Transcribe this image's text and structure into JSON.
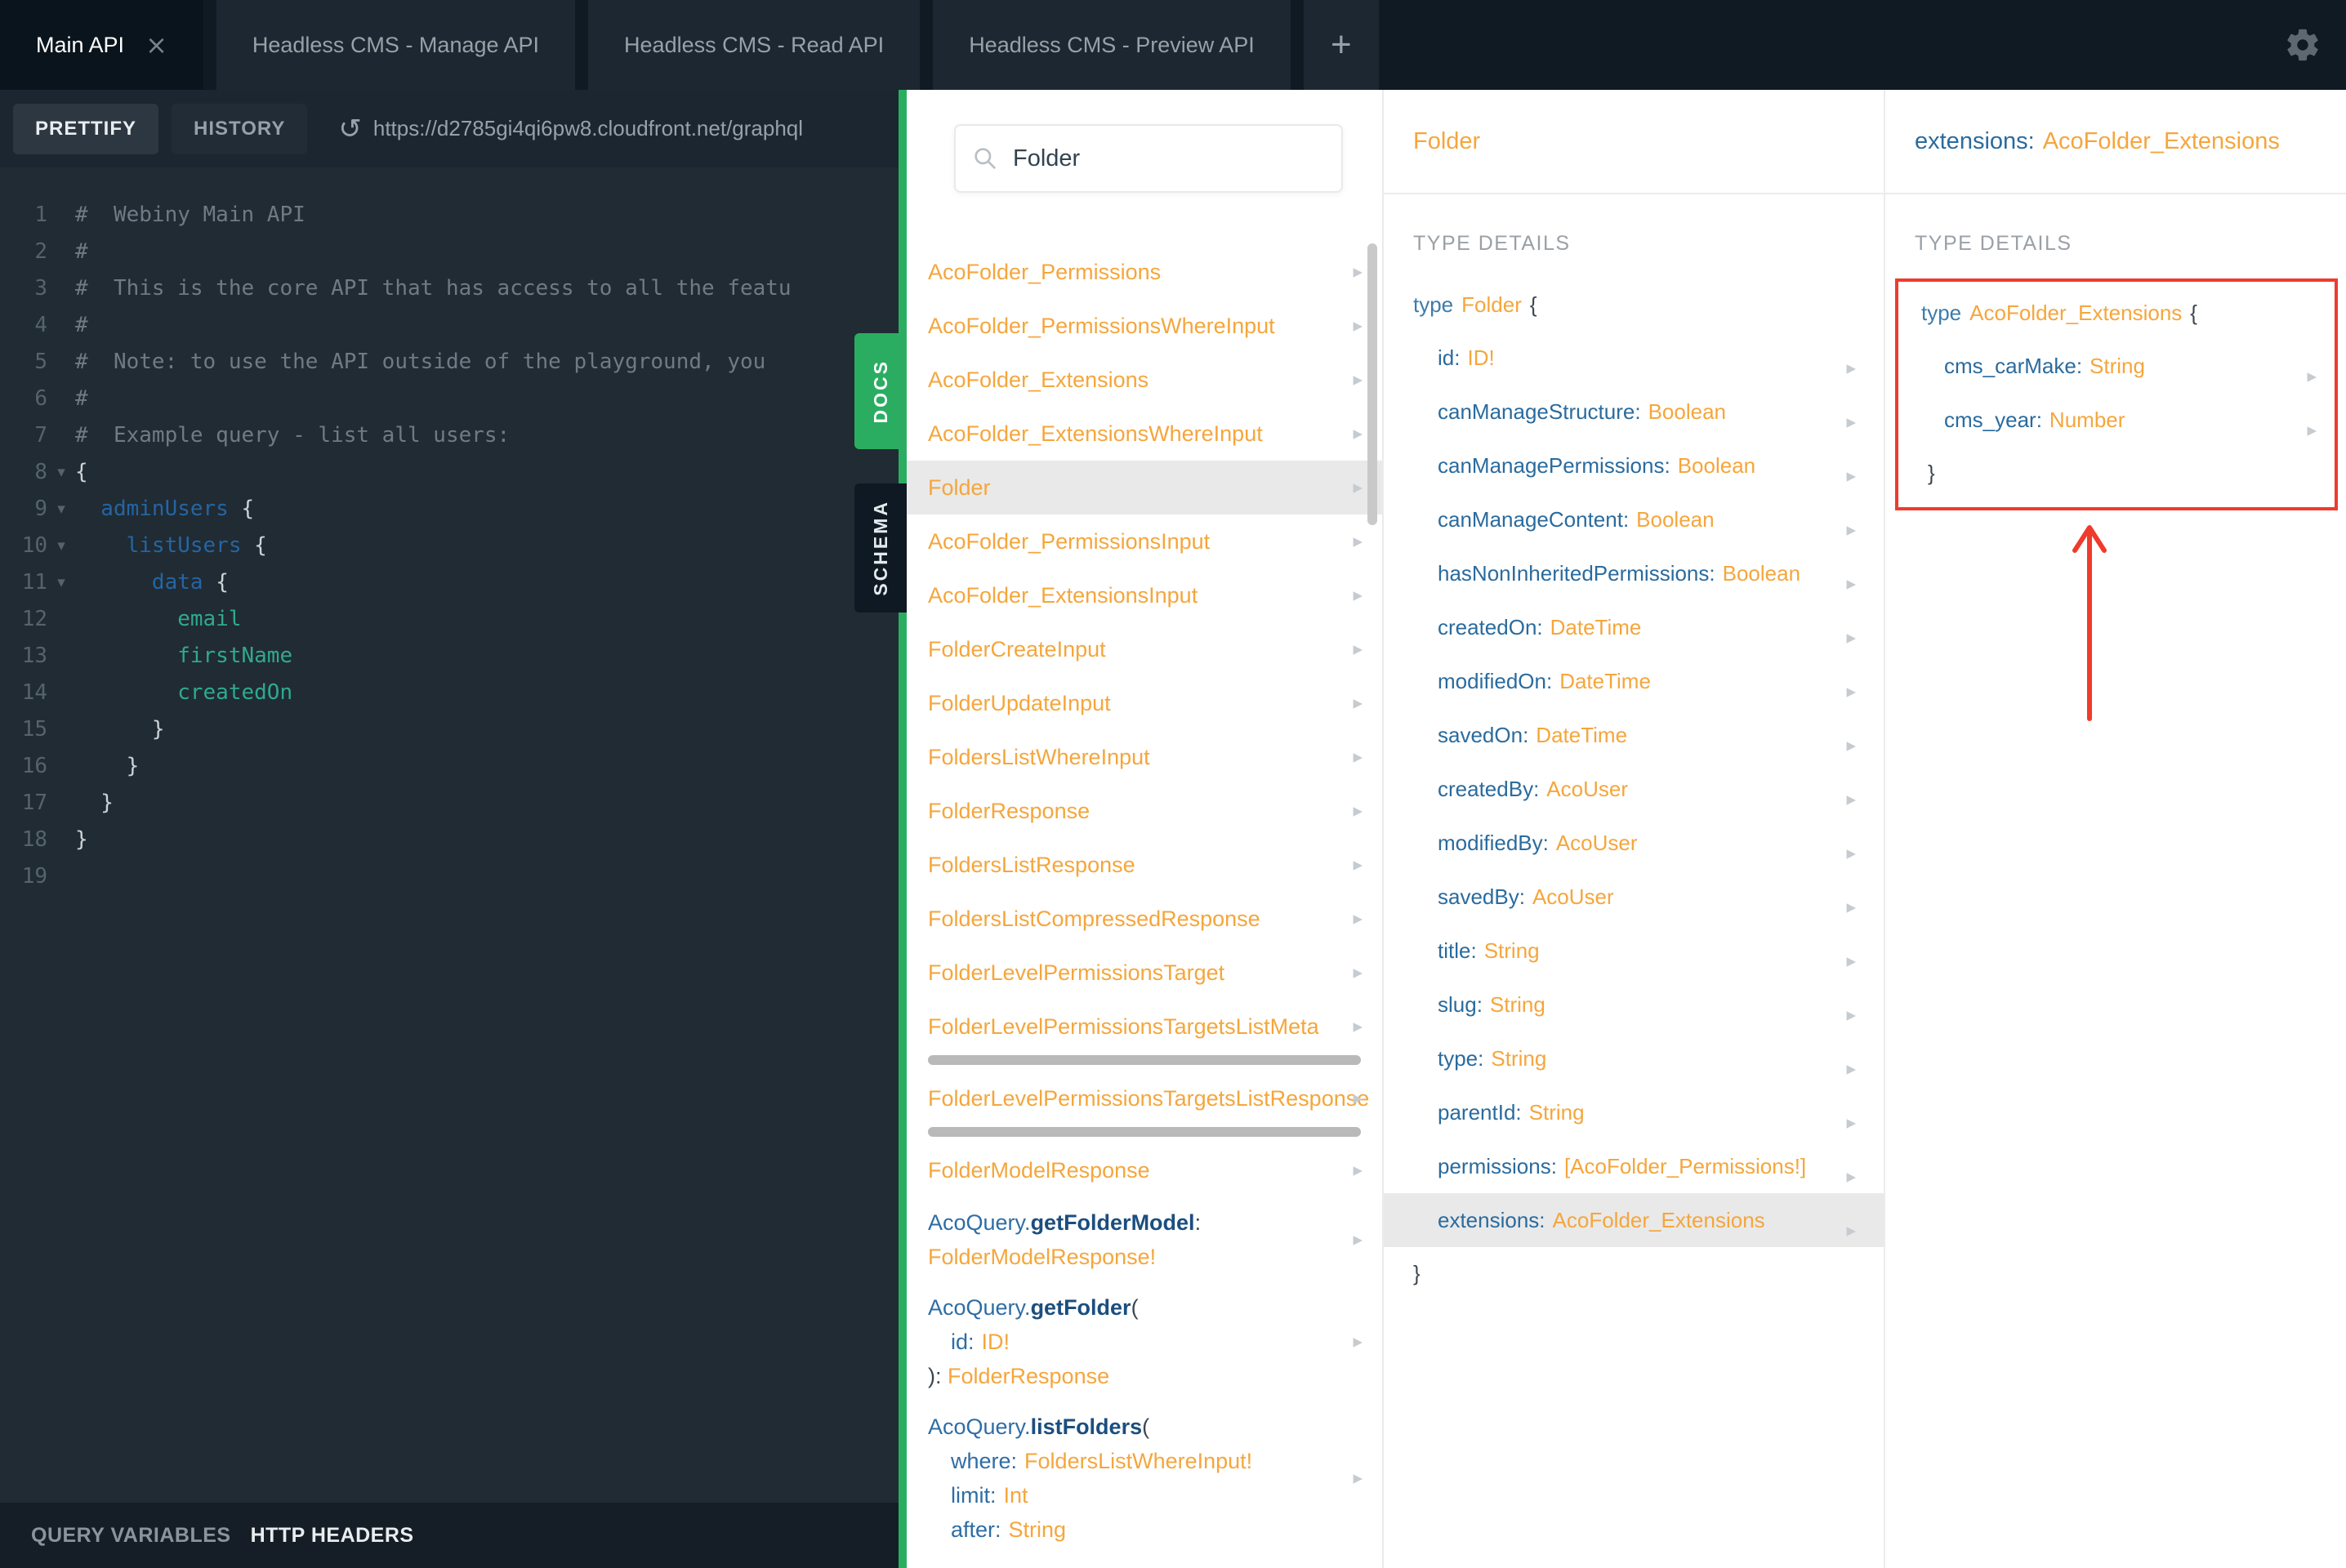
{
  "icons": {
    "chevron": "▸",
    "fold": "▾",
    "close": "×",
    "plus": "+",
    "refresh": "↺"
  },
  "tab_bar": {
    "tabs": [
      {
        "label": "Main API"
      },
      {
        "label": "Headless CMS - Manage API"
      },
      {
        "label": "Headless CMS - Read API"
      },
      {
        "label": "Headless CMS - Preview API"
      }
    ]
  },
  "toolbar": {
    "prettify": "PRETTIFY",
    "history": "HISTORY",
    "url": "https://d2785gi4qi6pw8.cloudfront.net/graphql"
  },
  "editor": {
    "lines": [
      {
        "n": "1",
        "s0": "#  Webiny Main API"
      },
      {
        "n": "2",
        "s0": "#"
      },
      {
        "n": "3",
        "s0": "#  This is the core API that has access to all the featu"
      },
      {
        "n": "4",
        "s0": "#"
      },
      {
        "n": "5",
        "s0": "#  Note: to use the API outside of the playground, you"
      },
      {
        "n": "6",
        "s0": "#"
      },
      {
        "n": "7",
        "s0": "#  Example query - list all users:"
      },
      {
        "n": "8",
        "fold": "▾",
        "s0": "{"
      },
      {
        "n": "9",
        "fold": "▾",
        "s0": "  adminUsers ",
        "s1": "{"
      },
      {
        "n": "10",
        "fold": "▾",
        "s0": "    listUsers ",
        "s1": "{"
      },
      {
        "n": "11",
        "fold": "▾",
        "s0": "      data ",
        "s1": "{"
      },
      {
        "n": "12",
        "s0": "        email"
      },
      {
        "n": "13",
        "s0": "        firstName"
      },
      {
        "n": "14",
        "s0": "        createdOn"
      },
      {
        "n": "15",
        "s0": "      }"
      },
      {
        "n": "16",
        "s0": "    }"
      },
      {
        "n": "17",
        "s0": "  }"
      },
      {
        "n": "18",
        "s0": "}"
      },
      {
        "n": "19",
        "s0": ""
      }
    ]
  },
  "bottom_bar": {
    "query_variables": "QUERY VARIABLES",
    "http_headers": "HTTP HEADERS"
  },
  "side_tabs": {
    "docs": "DOCS",
    "schema": "SCHEMA"
  },
  "docs_panel": {
    "search_value": "Folder",
    "items": [
      {
        "label": "AcoFolder_Permissions"
      },
      {
        "label": "AcoFolder_PermissionsWhereInput"
      },
      {
        "label": "AcoFolder_Extensions"
      },
      {
        "label": "AcoFolder_ExtensionsWhereInput"
      },
      {
        "label": "Folder"
      },
      {
        "label": "AcoFolder_PermissionsInput"
      },
      {
        "label": "AcoFolder_ExtensionsInput"
      },
      {
        "label": "FolderCreateInput"
      },
      {
        "label": "FolderUpdateInput"
      },
      {
        "label": "FoldersListWhereInput"
      },
      {
        "label": "FolderResponse"
      },
      {
        "label": "FoldersListResponse"
      },
      {
        "label": "FoldersListCompressedResponse"
      },
      {
        "label": "FolderLevelPermissionsTarget"
      },
      {
        "label": "FolderLevelPermissionsTargetsListMeta"
      },
      {
        "label": "FolderLevelPermissionsTargetsListResponse"
      },
      {
        "label": "FolderModelResponse"
      }
    ],
    "queries": [
      {
        "path": "AcoQuery.",
        "name": "getFolderModel",
        "sep": ":",
        "ret": "FolderModelResponse!"
      },
      {
        "path": "AcoQuery.",
        "name": "getFolder",
        "open": "(",
        "args": [
          {
            "n": "id:",
            "t": "ID!"
          }
        ],
        "close": "): ",
        "ret": "FolderResponse"
      },
      {
        "path": "AcoQuery.",
        "name": "listFolders",
        "open": "(",
        "args": [
          {
            "n": "where:",
            "t": "FoldersListWhereInput!"
          },
          {
            "n": "limit:",
            "t": "Int"
          },
          {
            "n": "after:",
            "t": "String"
          }
        ]
      }
    ]
  },
  "type_panel": {
    "header": "Folder",
    "section": "TYPE DETAILS",
    "kw": "type",
    "type_name": "Folder",
    "open_brace": "{",
    "close_brace": "}",
    "fields": [
      {
        "name": "id:",
        "type": "ID!"
      },
      {
        "name": "canManageStructure:",
        "type": "Boolean"
      },
      {
        "name": "canManagePermissions:",
        "type": "Boolean"
      },
      {
        "name": "canManageContent:",
        "type": "Boolean"
      },
      {
        "name": "hasNonInheritedPermissions:",
        "type": "Boolean"
      },
      {
        "name": "createdOn:",
        "type": "DateTime"
      },
      {
        "name": "modifiedOn:",
        "type": "DateTime"
      },
      {
        "name": "savedOn:",
        "type": "DateTime"
      },
      {
        "name": "createdBy:",
        "type": "AcoUser"
      },
      {
        "name": "modifiedBy:",
        "type": "AcoUser"
      },
      {
        "name": "savedBy:",
        "type": "AcoUser"
      },
      {
        "name": "title:",
        "type": "String"
      },
      {
        "name": "slug:",
        "type": "String"
      },
      {
        "name": "type:",
        "type": "String"
      },
      {
        "name": "parentId:",
        "type": "String"
      },
      {
        "name": "permissions:",
        "type": "[AcoFolder_Permissions!]"
      },
      {
        "name": "extensions:",
        "type": "AcoFolder_Extensions"
      }
    ]
  },
  "extension_panel": {
    "header_field": "extensions:",
    "header_type": "AcoFolder_Extensions",
    "section": "TYPE DETAILS",
    "kw": "type",
    "type_name": "AcoFolder_Extensions",
    "open_brace": "{",
    "close_brace": "}",
    "fields": [
      {
        "name": "cms_carMake:",
        "type": "String"
      },
      {
        "name": "cms_year:",
        "type": "Number"
      }
    ],
    "annotation_color": "#ef3b2d"
  }
}
